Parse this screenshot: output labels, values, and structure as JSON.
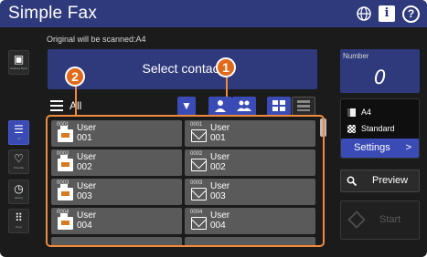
{
  "app": {
    "title": "Simple Fax"
  },
  "header_icons": [
    "globe-icon",
    "info-icon",
    "help-icon"
  ],
  "status": {
    "original_text": "Original will be scanned:A4"
  },
  "sidebar": {
    "items": [
      {
        "name": "address-book",
        "label": "Address Book",
        "icon": "address-book-icon",
        "active": false
      },
      {
        "name": "all",
        "label": "All",
        "icon": "list-icon",
        "active": true
      },
      {
        "name": "favorite",
        "label": "Favorite",
        "icon": "heart-icon",
        "active": false
      },
      {
        "name": "history",
        "label": "History",
        "icon": "clock-icon",
        "active": false
      },
      {
        "name": "keys",
        "label": "Keys",
        "icon": "keypad-icon",
        "active": false
      }
    ]
  },
  "main": {
    "select_contact_label": "Select contact",
    "list_label": "All",
    "toolbar": [
      "filter-icon",
      "person-icon",
      "group-icon",
      "grid-view-icon",
      "list-view-icon"
    ],
    "callouts": [
      "1",
      "2"
    ],
    "contacts": [
      {
        "num": "0001",
        "name": "User",
        "id": "001",
        "type": "fax"
      },
      {
        "num": "0001",
        "name": "User",
        "id": "001",
        "type": "email"
      },
      {
        "num": "0002",
        "name": "User",
        "id": "002",
        "type": "fax"
      },
      {
        "num": "0002",
        "name": "User",
        "id": "002",
        "type": "email"
      },
      {
        "num": "0003",
        "name": "User",
        "id": "003",
        "type": "fax"
      },
      {
        "num": "0003",
        "name": "User",
        "id": "003",
        "type": "email"
      },
      {
        "num": "0004",
        "name": "User",
        "id": "004",
        "type": "fax"
      },
      {
        "num": "0004",
        "name": "User",
        "id": "004",
        "type": "email"
      }
    ]
  },
  "right": {
    "number_label": "Number",
    "number_value": "0",
    "paper_size": "A4",
    "quality": "Standard",
    "settings_label": "Settings",
    "settings_chevron": ">",
    "preview_label": "Preview",
    "start_label": "Start"
  },
  "colors": {
    "title_bar": "#2f3a7c",
    "accent": "#3a4bb6",
    "highlight": "#f08a3c",
    "card": "#5a5a5a",
    "fax_orange": "#d87a1f"
  }
}
